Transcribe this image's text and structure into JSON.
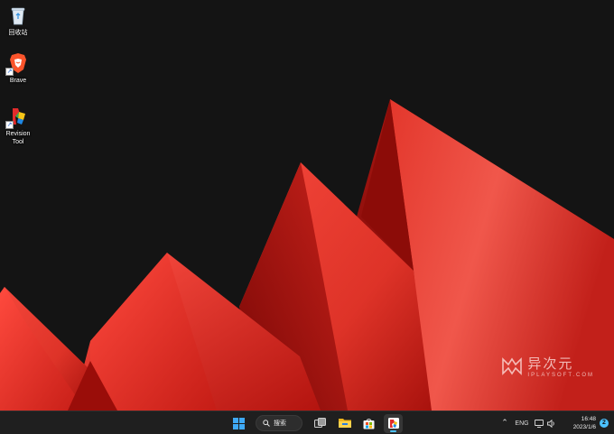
{
  "desktop": {
    "icons": [
      {
        "label": "回收站",
        "icon": "recycle-bin-icon"
      },
      {
        "label": "Brave",
        "icon": "brave-lion-icon"
      },
      {
        "label": "Revision\nTool",
        "icon": "revision-tool-icon"
      }
    ],
    "watermark": {
      "chinese": "异次元",
      "english": "IPLAYSOFT.COM"
    }
  },
  "taskbar": {
    "search_label": "搜索",
    "apps": [
      "start-icon",
      "search-icon",
      "task-view-icon",
      "file-explorer-icon",
      "microsoft-store-icon",
      "revision-tool-icon"
    ],
    "tray": {
      "language": "ENG",
      "time": "16:48",
      "date": "2023/1/6",
      "notification_count": "2"
    }
  },
  "colors": {
    "accent": "#4cc2ff",
    "wallpaper_red": "#e8372c",
    "wallpaper_dark": "#141414"
  }
}
